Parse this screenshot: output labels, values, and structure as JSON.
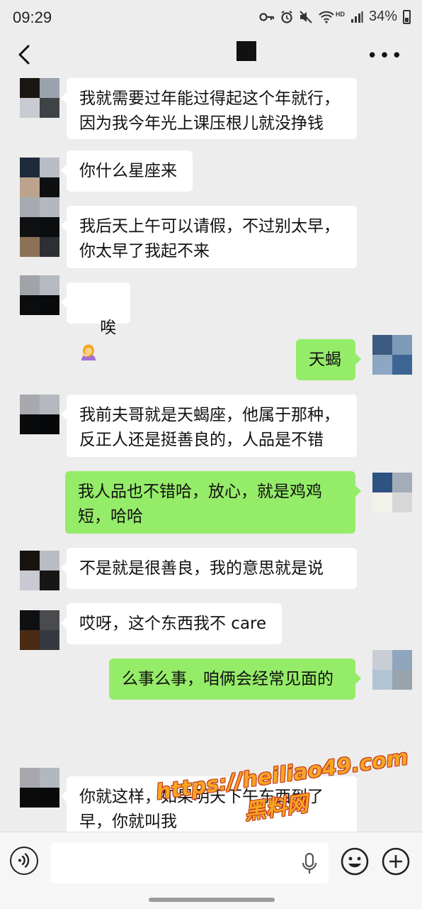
{
  "status_bar": {
    "time": "09:29",
    "network": "HD",
    "battery": "34%"
  },
  "colors": {
    "background": "#ededed",
    "bubble_incoming": "#ffffff",
    "bubble_outgoing": "#95ec69",
    "watermark": "#f6a623"
  },
  "messages": [
    {
      "from": "them",
      "text": "我就需要过年能过得起这个年就行，\n因为我今年光上课压根儿就没挣钱"
    },
    {
      "from": "them",
      "text": "你什么星座来"
    },
    {
      "from": "them",
      "text": "我后天上午可以请假，不过别太早，\n你太早了我起不来"
    },
    {
      "from": "them",
      "text": "唉",
      "emoji": "facepalm-woman-emoji"
    },
    {
      "from": "me",
      "text": "天蝎"
    },
    {
      "from": "them",
      "text": "我前夫哥就是天蝎座，他属于那种，\n反正人还是挺善良的，人品是不错"
    },
    {
      "from": "me",
      "text": "我人品也不错哈，放心，就是鸡鸡\n短，哈哈"
    },
    {
      "from": "them",
      "text": "不是就是很善良，我的意思就是说"
    },
    {
      "from": "them",
      "text": "哎呀，这个东西我不 care"
    },
    {
      "from": "me",
      "text": "么事么事，咱俩会经常见面的"
    },
    {
      "from": "them",
      "text": "你就这样，如果明天下午东西到了\n早，你就叫我"
    }
  ],
  "watermark": {
    "url": "https://heiliao49.com",
    "label": "黑料网"
  },
  "input_bar": {
    "text_value": ""
  }
}
